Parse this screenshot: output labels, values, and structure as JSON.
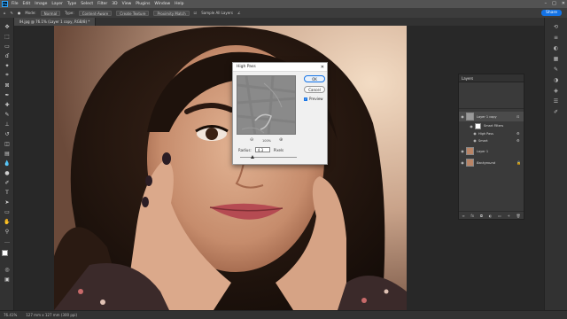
{
  "app": {
    "logo": "Ps",
    "menu": [
      "File",
      "Edit",
      "Image",
      "Layer",
      "Type",
      "Select",
      "Filter",
      "3D",
      "View",
      "Plugins",
      "Window",
      "Help"
    ],
    "window_controls": [
      "–",
      "□",
      "✕"
    ]
  },
  "options_bar": {
    "mode_label": "Mode:",
    "mode_value": "Normal",
    "type_label": "Type:",
    "type_options": [
      "Content-Aware",
      "Create Texture",
      "Proximity Match"
    ],
    "sample_all": "Sample All Layers",
    "share": "Share"
  },
  "document": {
    "tab_title": "IH.jpg @ 76.1% (Layer 1 copy, RGB/8) *",
    "status_zoom": "76.41%",
    "status_info": "127 mm x 127 mm (300 ppi)"
  },
  "dialog": {
    "title": "High Pass",
    "close": "✕",
    "ok": "OK",
    "cancel": "Cancel",
    "preview_label": "Preview",
    "zoom_value": "100%",
    "zoom_out": "⊖",
    "zoom_in": "⊕",
    "radius_label": "Radius:",
    "radius_value": "4.3",
    "radius_unit": "Pixels"
  },
  "layers_panel": {
    "title": "Layers",
    "layers": [
      {
        "name": "Layer 1 copy",
        "selected": true
      },
      {
        "name": "Smart Filters"
      },
      {
        "name": "High Pass"
      },
      {
        "name": "Smart"
      },
      {
        "name": "Layer 1"
      },
      {
        "name": "Background"
      }
    ],
    "footer_icons": [
      "link-icon",
      "fx-icon",
      "mask-icon",
      "adjust-icon",
      "folder-icon",
      "new-layer-icon",
      "trash-icon"
    ]
  },
  "colors": {
    "accent": "#1473e6",
    "panel": "#3a3a3a",
    "chrome": "#323232",
    "menubar": "#535353"
  }
}
